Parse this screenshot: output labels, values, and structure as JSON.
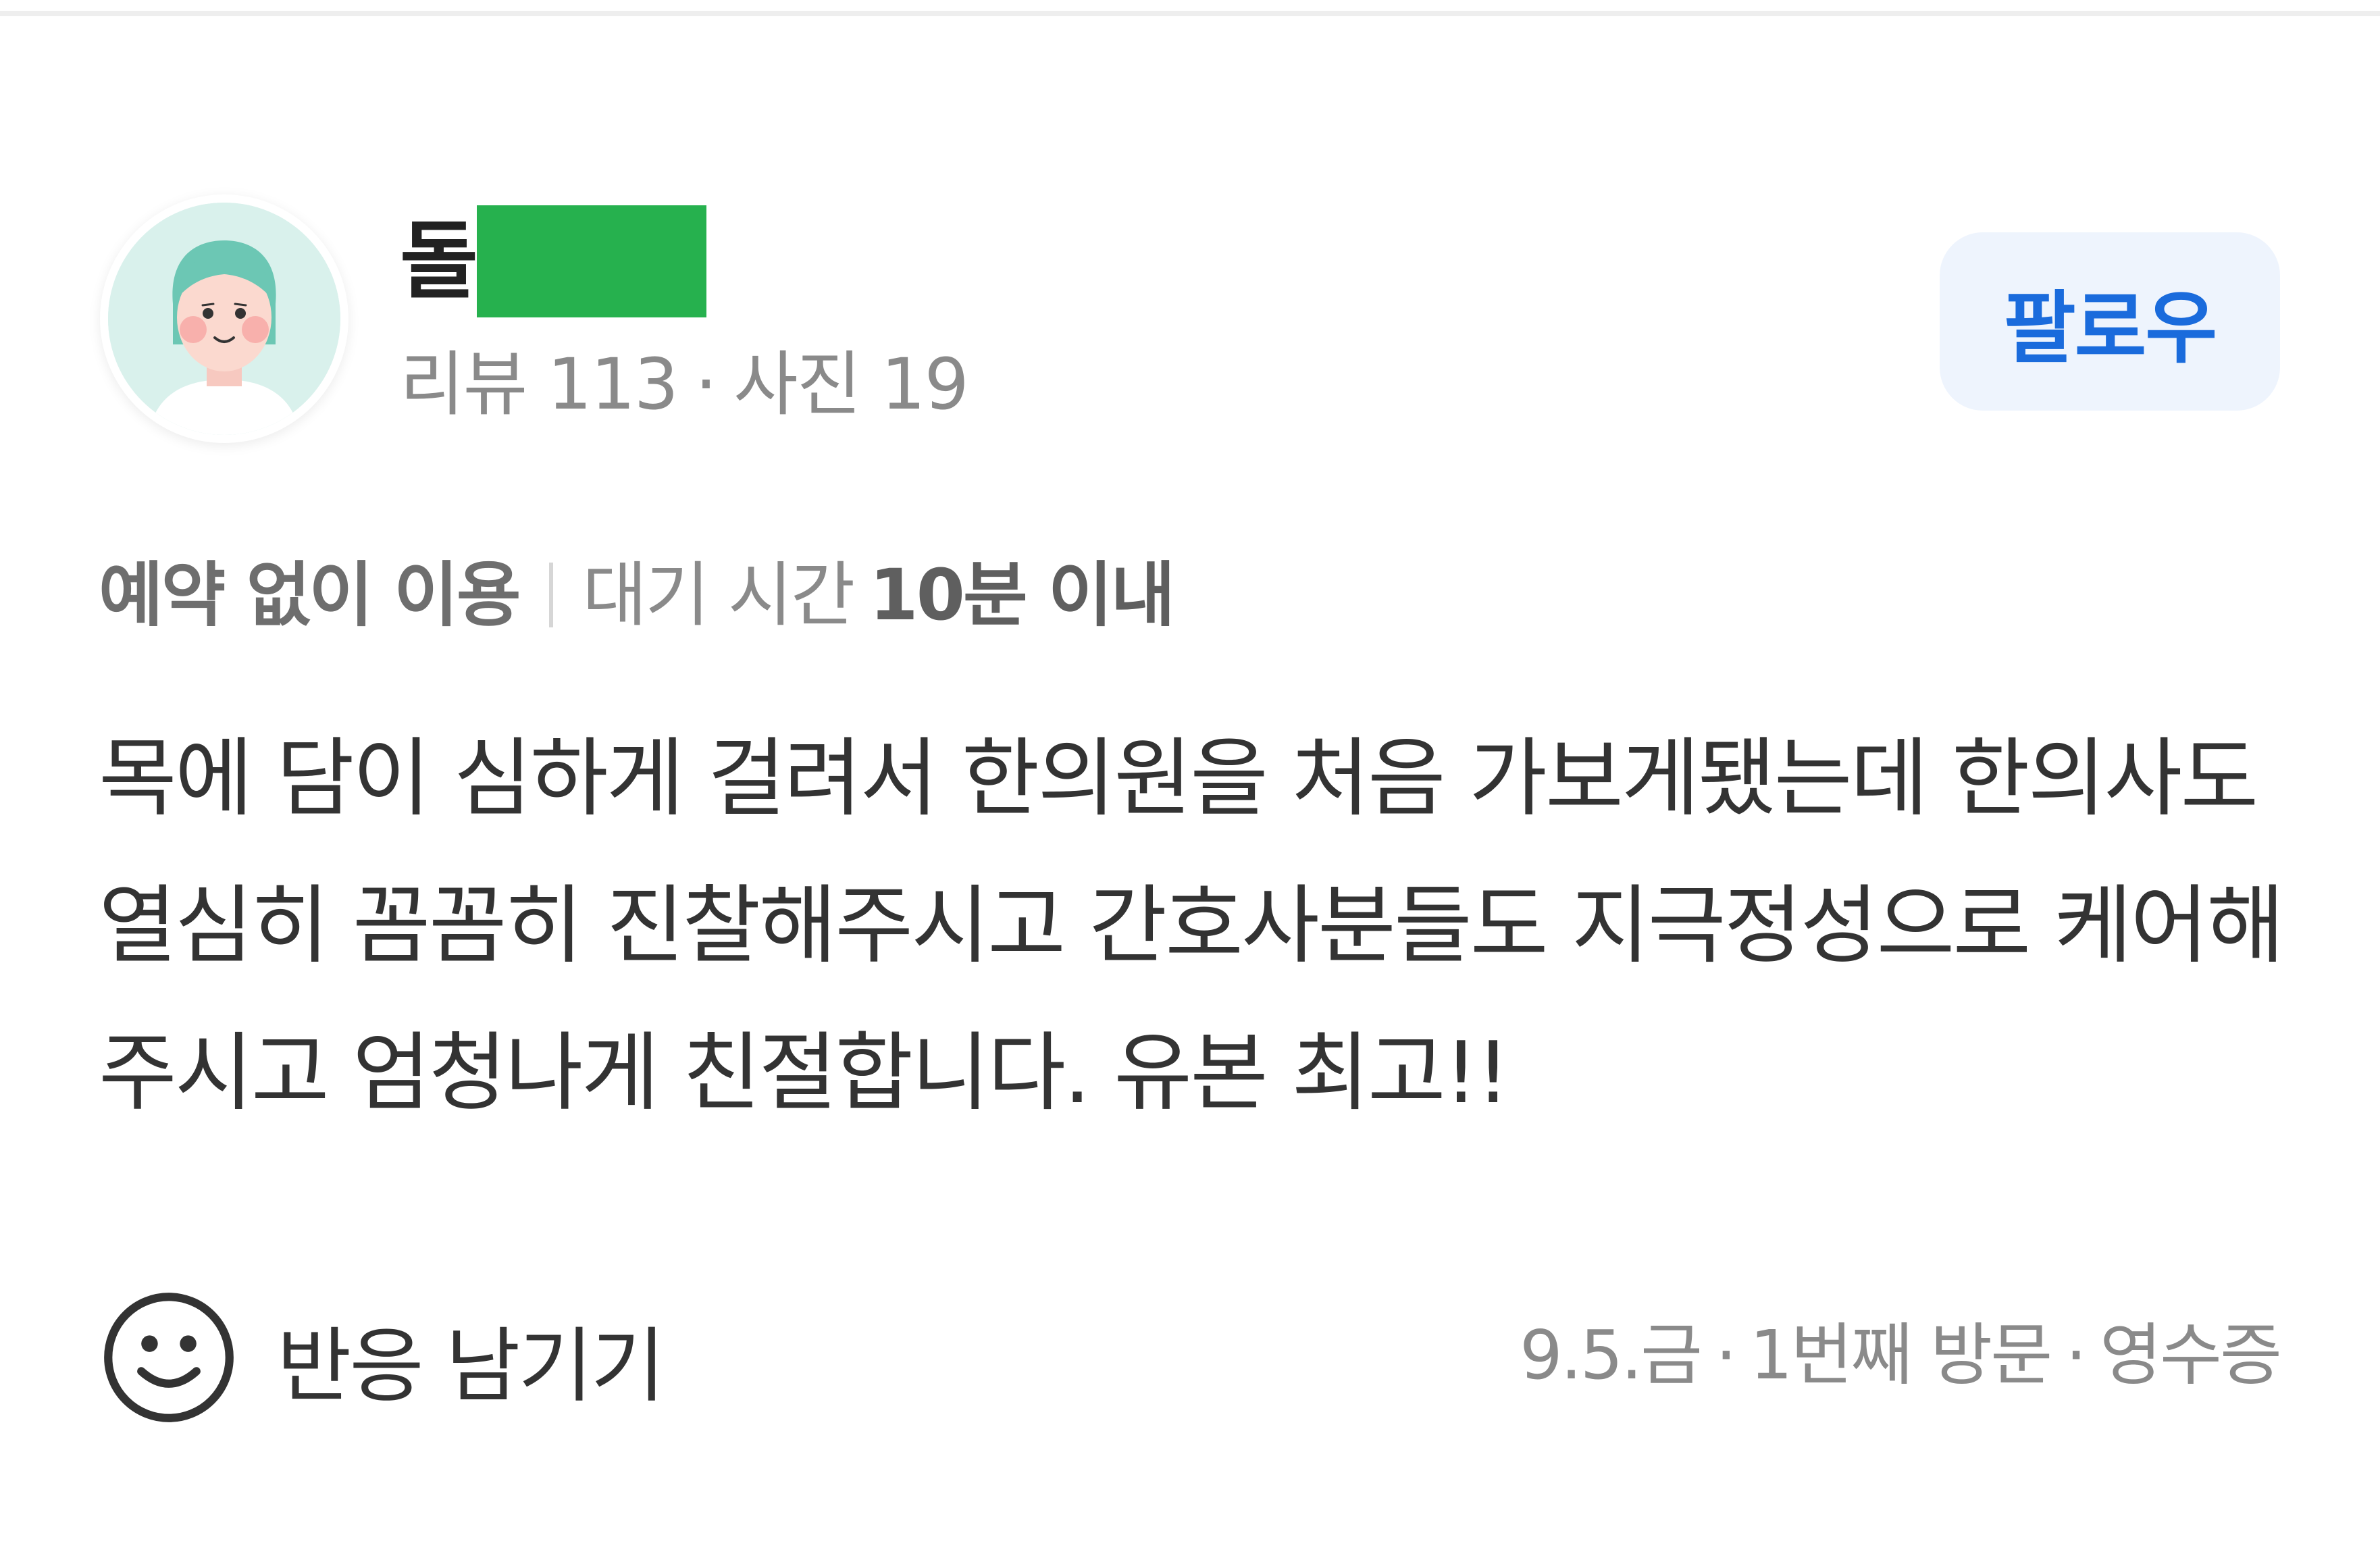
{
  "review": {
    "author": {
      "nickname_visible": "돌",
      "avatar_icon": "user-avatar-illustration",
      "review_count_label": "리뷰 113",
      "photo_count_label": "사진 19",
      "separator": "·"
    },
    "follow_label": "팔로우",
    "meta": {
      "reservation": "예약 없이 이용",
      "wait_label": "대기 시간",
      "wait_value": "10분 이내"
    },
    "body_lines": [
      "목에 담이 심하게 걸려서 한의원을 처음 가보게됐는데 한의사도",
      "열심히 꼼꼼히 진찰해주시고 간호사분들도 지극정성으로 케어해",
      "주시고 엄청나게 친절합니다. 유본 최고!!"
    ],
    "reaction_label": "반응 남기기",
    "reaction_icon": "smiley-face-icon",
    "visit": {
      "date": "9.5.금",
      "visit_count": "1번째 방문",
      "verification": "영수증",
      "separator": "·"
    }
  },
  "colors": {
    "follow_text": "#1a6bdc",
    "follow_bg": "#eef4fd",
    "mask_green": "#26b14e",
    "muted_text": "#8a8a8a"
  }
}
